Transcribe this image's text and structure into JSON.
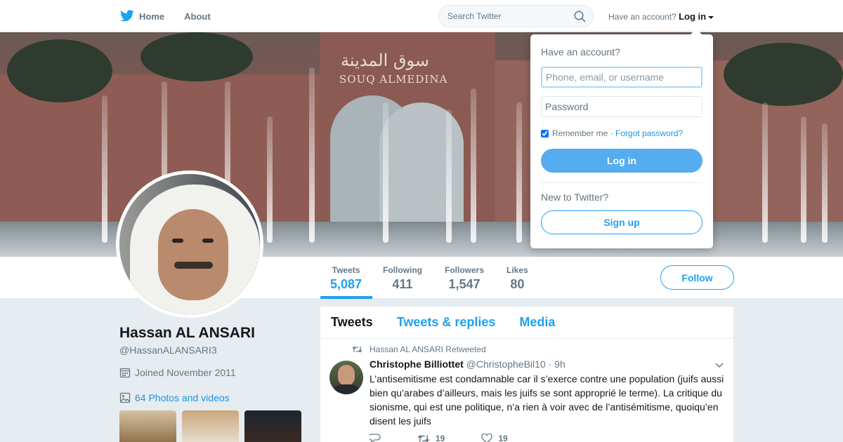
{
  "nav": {
    "home_label": "Home",
    "about_label": "About",
    "search_placeholder": "Search Twitter",
    "have_account": "Have an account?",
    "login_label": "Log in"
  },
  "banner": {
    "sign_arabic": "سوق المدينة",
    "sign_english": "SOUQ ALMEDINA"
  },
  "profile_nav": {
    "stats": [
      {
        "label": "Tweets",
        "value": "5,087"
      },
      {
        "label": "Following",
        "value": "411"
      },
      {
        "label": "Followers",
        "value": "1,547"
      },
      {
        "label": "Likes",
        "value": "80"
      }
    ],
    "follow_label": "Follow"
  },
  "profile": {
    "name": "Hassan AL ANSARI",
    "handle": "@HassanALANSARI3",
    "joined": "Joined November 2011",
    "photos_link": "64 Photos and videos"
  },
  "timeline": {
    "tabs": [
      "Tweets",
      "Tweets & replies",
      "Media"
    ],
    "tweet": {
      "retweet_context": "Hassan AL ANSARI Retweeted",
      "name": "Christophe Billiottet",
      "handle": "@ChristopheBil10",
      "time": "· 9h",
      "text": "L’antisemitisme est condamnable car il s’exerce contre une population (juifs aussi bien qu’arabes d’ailleurs, mais les juifs se sont approprié le terme). La critique du sionisme, qui est une politique, n’a rien à voir avec de l’antisémitisme, quoiqu’en disent les juifs",
      "retweets": "19",
      "likes": "19"
    }
  },
  "login_dropdown": {
    "title": "Have an account?",
    "username_placeholder": "Phone, email, or username",
    "password_placeholder": "Password",
    "remember_label": "Remember me",
    "separator": "·",
    "forgot_label": "Forgot password?",
    "login_button": "Log in",
    "new_label": "New to Twitter?",
    "signup_button": "Sign up"
  },
  "colors": {
    "accent": "#1da1f2",
    "link": "#1b95e0",
    "login_button": "#55acee",
    "background": "#e6ecf0"
  },
  "icons": [
    "twitter-bird-icon",
    "search-icon",
    "caret-down-icon",
    "calendar-icon",
    "photo-icon",
    "retweet-icon",
    "chevron-down-icon",
    "reply-icon",
    "like-icon"
  ]
}
